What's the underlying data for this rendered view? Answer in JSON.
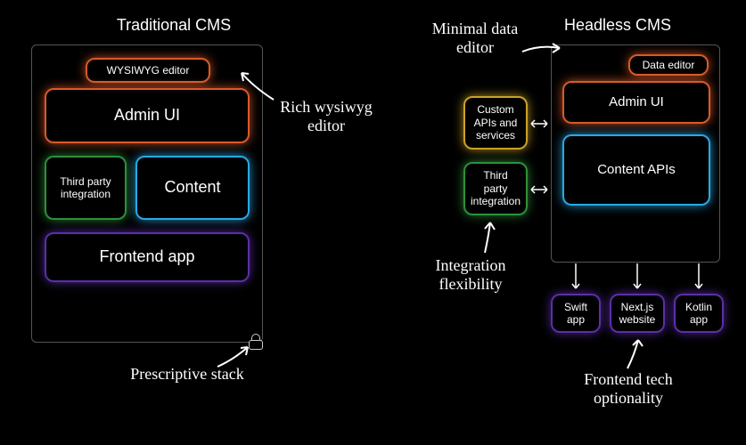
{
  "left": {
    "title": "Traditional CMS",
    "wysiwyg": "WYSIWYG editor",
    "admin": "Admin UI",
    "third": "Third party integration",
    "content": "Content",
    "frontend": "Frontend app",
    "note_rich": "Rich wysiwyg editor",
    "note_stack": "Prescriptive stack"
  },
  "right": {
    "title": "Headless CMS",
    "editor": "Data editor",
    "admin": "Admin UI",
    "content": "Content APIs",
    "custom": "Custom APIs and services",
    "third": "Third party integration",
    "swift": "Swift app",
    "next": "Next.js website",
    "kotlin": "Kotlin app",
    "note_minimal": "Minimal data editor",
    "note_integ": "Integration flexibility",
    "note_frontend": "Frontend tech optionality"
  }
}
